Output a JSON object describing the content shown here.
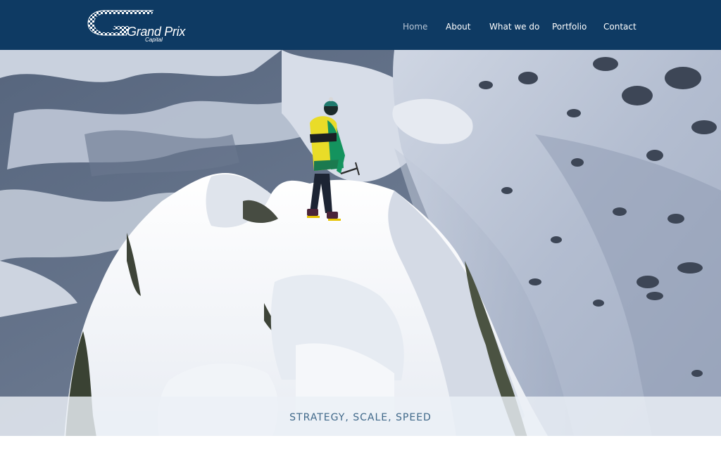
{
  "header": {
    "logo": {
      "name": "Grand Prix",
      "sub": "Capital"
    },
    "nav": [
      {
        "label": "Home",
        "active": true
      },
      {
        "label": "About",
        "active": false
      },
      {
        "label": "What we do",
        "active": false
      },
      {
        "label": "Portfolio",
        "active": false
      },
      {
        "label": "Contact",
        "active": false
      }
    ],
    "colors": {
      "background": "#0e3a63",
      "nav_text": "#ffffff",
      "nav_active": "#b8c6d6"
    }
  },
  "hero": {
    "image": "mountaineer-on-snowy-summit-photo",
    "tagline": "STRATEGY, SCALE, SPEED",
    "tagline_color": "#3f6889"
  }
}
